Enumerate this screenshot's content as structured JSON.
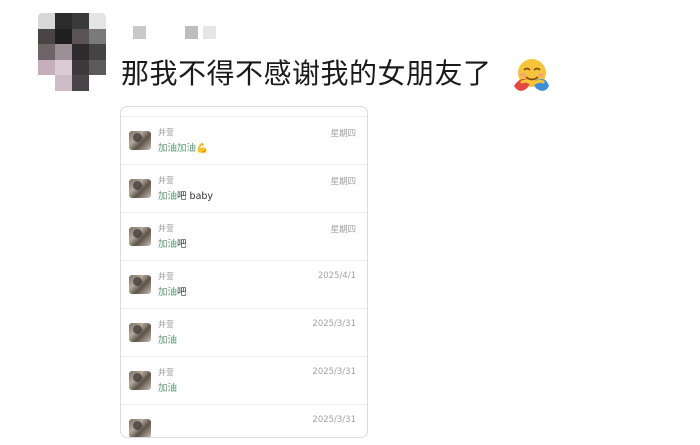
{
  "post": {
    "text": "那我不得不感谢我的女朋友了",
    "emoji": "hug-emoji"
  },
  "colors": {
    "accent_green": "#5a9a72",
    "text_gray": "#9a9a9a"
  },
  "messages": [
    {
      "name": "",
      "date": "",
      "green": "加油",
      "dark": "吧"
    },
    {
      "name": "井萱",
      "date": "星期四",
      "green": "加油加油",
      "dark": "💪"
    },
    {
      "name": "井萱",
      "date": "星期四",
      "green": "加油",
      "dark": "吧 baby"
    },
    {
      "name": "井萱",
      "date": "星期四",
      "green": "加油",
      "dark": "吧"
    },
    {
      "name": "井萱",
      "date": "2025/4/1",
      "green": "加油",
      "dark": "吧"
    },
    {
      "name": "井萱",
      "date": "2025/3/31",
      "green": "加油",
      "dark": ""
    },
    {
      "name": "井萱",
      "date": "2025/3/31",
      "green": "加油",
      "dark": ""
    },
    {
      "name": "",
      "date": "2025/3/31",
      "green": "",
      "dark": ""
    }
  ]
}
